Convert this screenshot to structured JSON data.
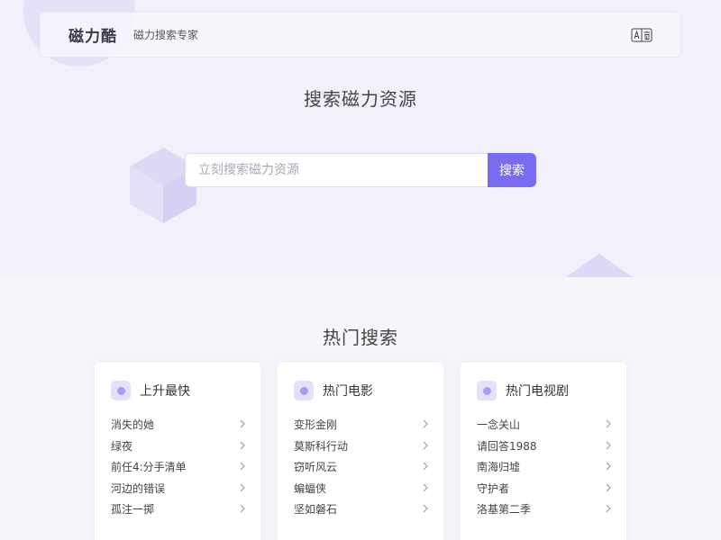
{
  "header": {
    "logo": "磁力酷",
    "slogan": "磁力搜索专家",
    "lang_icon": "translate-icon"
  },
  "hero": {
    "title": "搜索磁力资源"
  },
  "search": {
    "placeholder": "立刻搜索磁力资源",
    "value": "",
    "button_label": "搜索"
  },
  "hot": {
    "title": "热门搜索",
    "cards": [
      {
        "title": "上升最快",
        "items": [
          "消失的她",
          "绿夜",
          "前任4:分手清单",
          "河边的错误",
          "孤注一掷"
        ]
      },
      {
        "title": "热门电影",
        "items": [
          "变形金刚",
          "莫斯科行动",
          "窃听风云",
          "蝙蝠侠",
          "坚如磐石"
        ]
      },
      {
        "title": "热门电视剧",
        "items": [
          "一念关山",
          "请回答1988",
          "南海归墟",
          "守护者",
          "洛基第二季"
        ]
      }
    ]
  },
  "colors": {
    "accent": "#7a6cf0",
    "hero_bg": "#f2f0fb",
    "page_bg": "#f6f5fa"
  }
}
